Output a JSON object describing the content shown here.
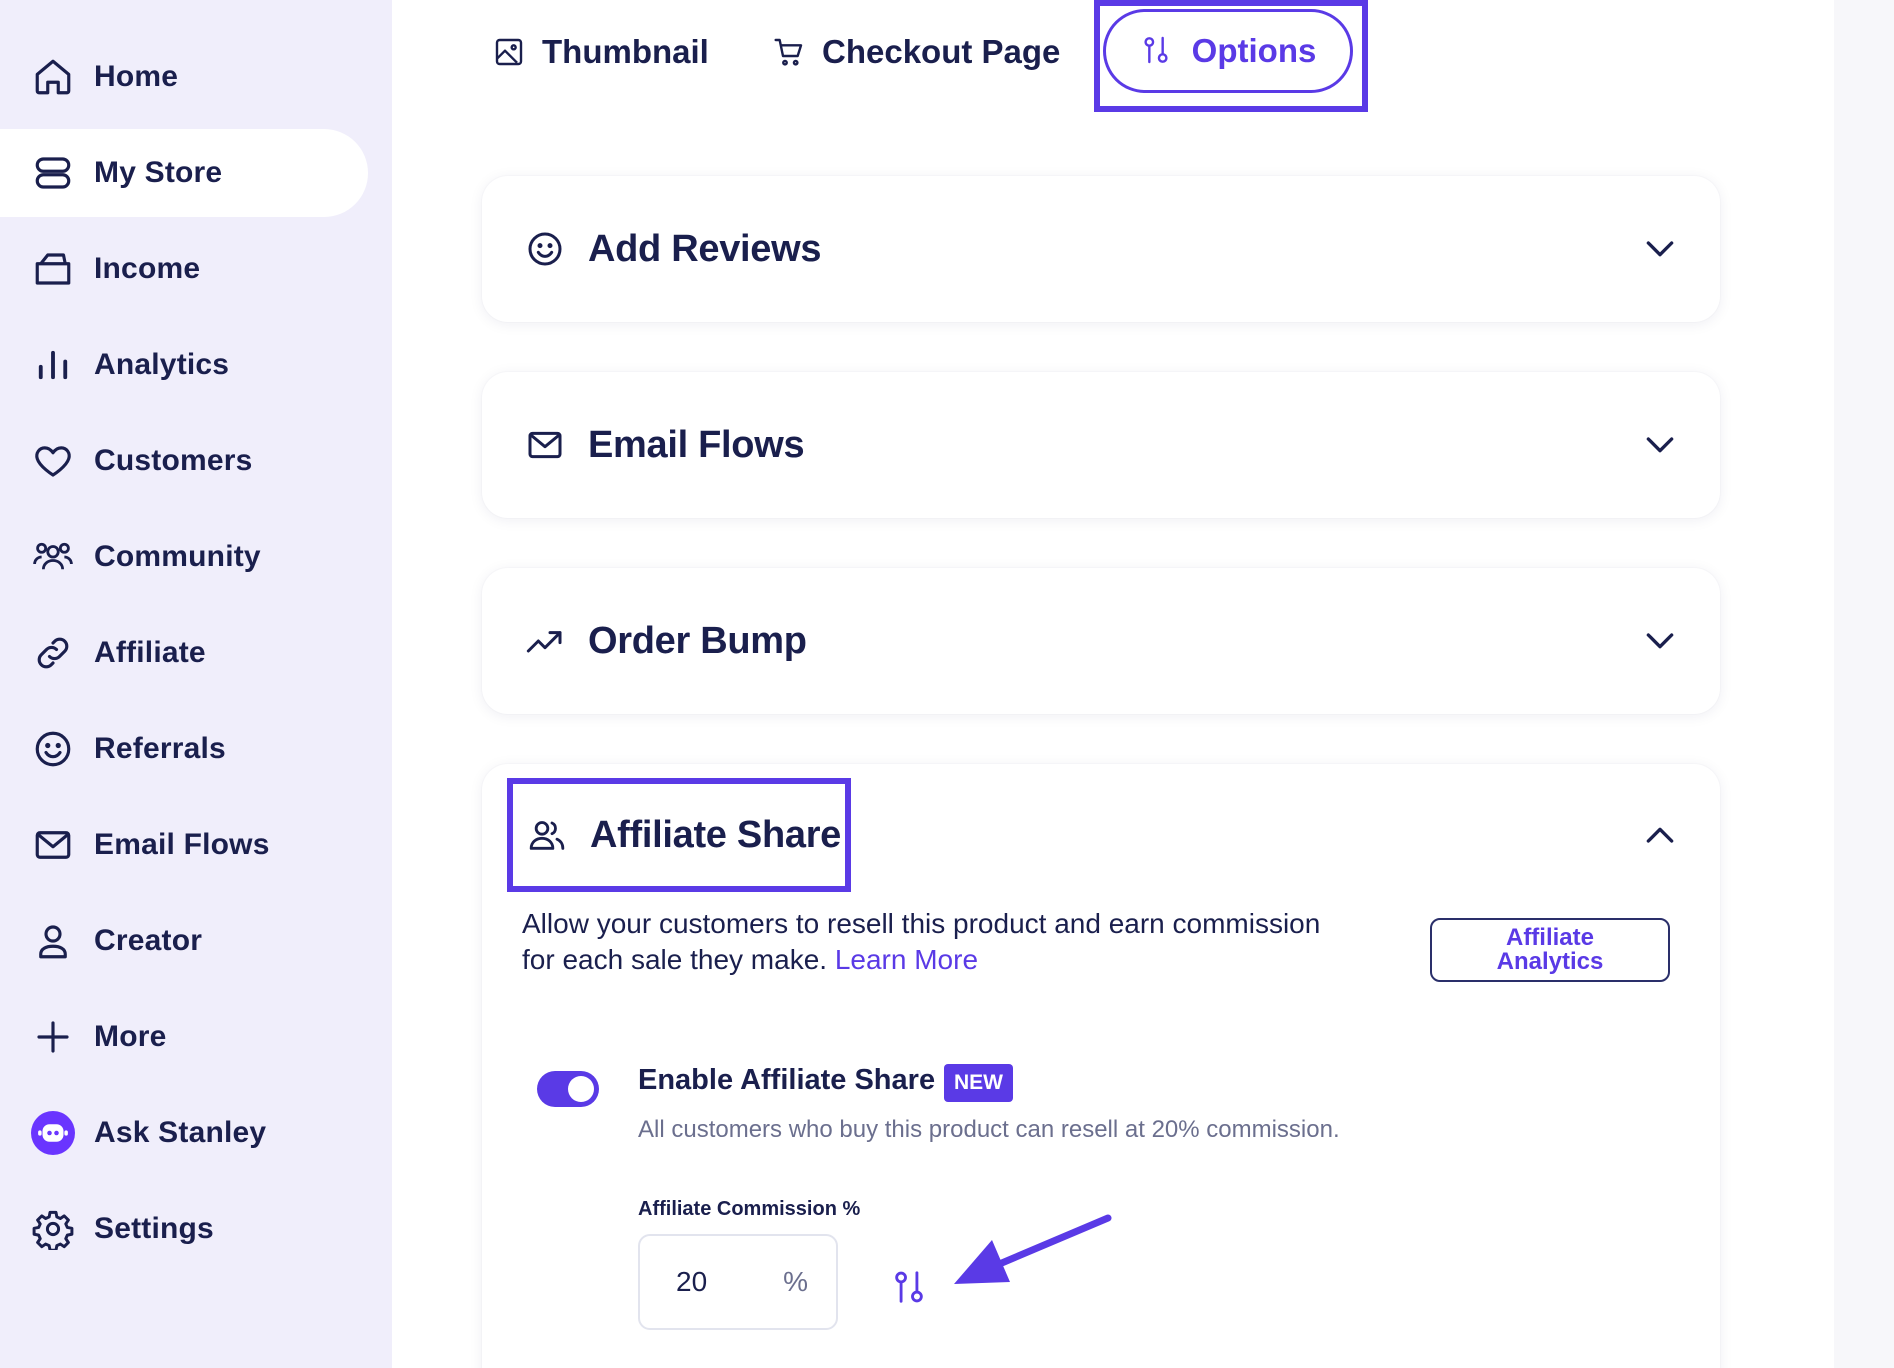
{
  "sidebar": {
    "items": [
      {
        "label": "Home",
        "icon": "home-icon",
        "active": false
      },
      {
        "label": "My Store",
        "icon": "store-icon",
        "active": true
      },
      {
        "label": "Income",
        "icon": "wallet-icon",
        "active": false
      },
      {
        "label": "Analytics",
        "icon": "analytics-icon",
        "active": false
      },
      {
        "label": "Customers",
        "icon": "heart-icon",
        "active": false
      },
      {
        "label": "Community",
        "icon": "community-icon",
        "active": false
      },
      {
        "label": "Affiliate",
        "icon": "link-icon",
        "active": false
      },
      {
        "label": "Referrals",
        "icon": "smile-icon",
        "active": false
      },
      {
        "label": "Email Flows",
        "icon": "mail-icon",
        "active": false
      },
      {
        "label": "Creator",
        "icon": "user-icon",
        "active": false
      },
      {
        "label": "More",
        "icon": "plus-icon",
        "active": false
      },
      {
        "label": "Ask Stanley",
        "icon": "stanley-avatar-icon",
        "active": false
      },
      {
        "label": "Settings",
        "icon": "gear-icon",
        "active": false
      }
    ]
  },
  "tabs": {
    "thumbnail": "Thumbnail",
    "checkout": "Checkout Page",
    "options": "Options",
    "active": "Options"
  },
  "sections": {
    "add_reviews": "Add Reviews",
    "email_flows": "Email Flows",
    "order_bump": "Order Bump",
    "affiliate_share": "Affiliate Share"
  },
  "affiliate": {
    "description": "Allow your customers to resell this product and earn commission for each sale they make.",
    "learn_more": "Learn More",
    "analytics_button": "Affiliate Analytics",
    "enable_label": "Enable Affiliate Share",
    "new_badge": "NEW",
    "enabled": true,
    "enable_help": "All customers who buy this product can resell at 20% commission.",
    "commission_label": "Affiliate Commission %",
    "commission_value": "20",
    "commission_suffix": "%"
  },
  "colors": {
    "accent": "#5a3ae6",
    "text": "#1a1f4d",
    "sidebar_bg": "#f0eefb",
    "muted": "#6b6f8e"
  }
}
